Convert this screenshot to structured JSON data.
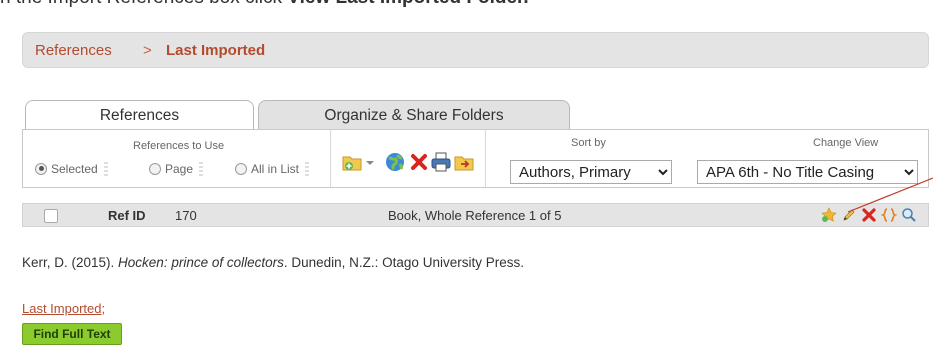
{
  "instruction": {
    "prefix": "n the Import References box click ",
    "emphasis": "View Last Imported Folder."
  },
  "breadcrumb": {
    "root": "References",
    "separator": ">",
    "current": "Last Imported"
  },
  "tabs": [
    {
      "label": "References",
      "active": true
    },
    {
      "label": "Organize & Share Folders",
      "active": false
    }
  ],
  "toolbar": {
    "refs_to_use_label": "References to Use",
    "options": [
      {
        "label": "Selected",
        "checked": true
      },
      {
        "label": "Page",
        "checked": false
      },
      {
        "label": "All in List",
        "checked": false
      }
    ],
    "icons": [
      "add-folder-icon",
      "dropdown-arrow-icon",
      "globe-icon",
      "delete-icon",
      "print-icon",
      "folder-export-icon"
    ],
    "sort_by_label": "Sort by",
    "sort_by_value": "Authors, Primary",
    "change_view_label": "Change View",
    "change_view_value": "APA 6th - No Title Casing"
  },
  "reference": {
    "id_label": "Ref ID",
    "id_value": "170",
    "type_text": "Book, Whole Reference 1 of 5",
    "actions": [
      "star-icon",
      "edit-pencil-icon",
      "delete-icon",
      "braces-icon",
      "magnifier-icon"
    ],
    "citation_pre": "Kerr, D. (2015). ",
    "citation_title": "Hocken: prince of collectors",
    "citation_post": ". Dunedin, N.Z.: Otago University Press.",
    "folder_link": "Last Imported",
    "folder_suffix": ";",
    "find_full_text": "Find Full Text"
  },
  "colors": {
    "brand_text": "#b34b2f",
    "bar_background": "#e4e4e4",
    "find_button": "#8ccb2e",
    "annotation_line": "#c0392b"
  }
}
